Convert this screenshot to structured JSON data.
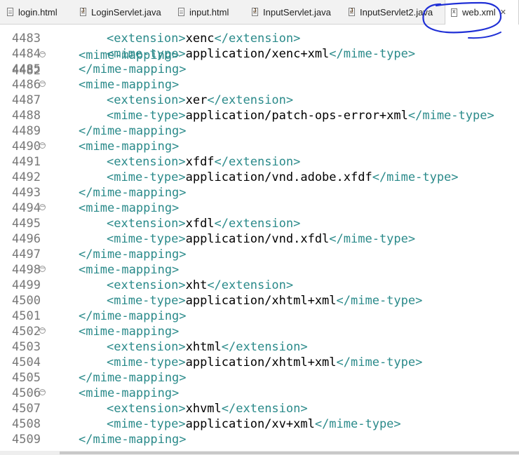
{
  "tabs": [
    {
      "label": "login.html",
      "icon": "html-file-icon"
    },
    {
      "label": "LoginServlet.java",
      "icon": "java-file-icon"
    },
    {
      "label": "input.html",
      "icon": "html-file-icon"
    },
    {
      "label": "InputServlet.java",
      "icon": "java-file-icon"
    },
    {
      "label": "InputServlet2.java",
      "icon": "java-file-icon"
    },
    {
      "label": "web.xml",
      "icon": "xml-file-icon",
      "active": true
    }
  ],
  "colors": {
    "tag": "#2a8a8a",
    "text": "#000000",
    "line_number": "#787878",
    "annotation": "#1f2fd6"
  },
  "editor": {
    "partial_top_line": {
      "num": "4482",
      "open": "<",
      "tag": "mime-mapping",
      "close": ">"
    },
    "lines": [
      {
        "num": "4483",
        "indent": 2,
        "open": "<extension>",
        "value": "xenc",
        "close": "</extension>"
      },
      {
        "num": "4484",
        "indent": 2,
        "open": "<mime-type>",
        "value": "application/xenc+xml",
        "close": "</mime-type>"
      },
      {
        "num": "4485",
        "indent": 1,
        "open": "</mime-mapping>"
      },
      {
        "num": "4486",
        "indent": 1,
        "open": "<mime-mapping>",
        "fold": true
      },
      {
        "num": "4487",
        "indent": 2,
        "open": "<extension>",
        "value": "xer",
        "close": "</extension>"
      },
      {
        "num": "4488",
        "indent": 2,
        "open": "<mime-type>",
        "value": "application/patch-ops-error+xml",
        "close": "</mime-type>"
      },
      {
        "num": "4489",
        "indent": 1,
        "open": "</mime-mapping>"
      },
      {
        "num": "4490",
        "indent": 1,
        "open": "<mime-mapping>",
        "fold": true
      },
      {
        "num": "4491",
        "indent": 2,
        "open": "<extension>",
        "value": "xfdf",
        "close": "</extension>"
      },
      {
        "num": "4492",
        "indent": 2,
        "open": "<mime-type>",
        "value": "application/vnd.adobe.xfdf",
        "close": "</mime-type>"
      },
      {
        "num": "4493",
        "indent": 1,
        "open": "</mime-mapping>"
      },
      {
        "num": "4494",
        "indent": 1,
        "open": "<mime-mapping>",
        "fold": true
      },
      {
        "num": "4495",
        "indent": 2,
        "open": "<extension>",
        "value": "xfdl",
        "close": "</extension>"
      },
      {
        "num": "4496",
        "indent": 2,
        "open": "<mime-type>",
        "value": "application/vnd.xfdl",
        "close": "</mime-type>"
      },
      {
        "num": "4497",
        "indent": 1,
        "open": "</mime-mapping>"
      },
      {
        "num": "4498",
        "indent": 1,
        "open": "<mime-mapping>",
        "fold": true
      },
      {
        "num": "4499",
        "indent": 2,
        "open": "<extension>",
        "value": "xht",
        "close": "</extension>"
      },
      {
        "num": "4500",
        "indent": 2,
        "open": "<mime-type>",
        "value": "application/xhtml+xml",
        "close": "</mime-type>"
      },
      {
        "num": "4501",
        "indent": 1,
        "open": "</mime-mapping>"
      },
      {
        "num": "4502",
        "indent": 1,
        "open": "<mime-mapping>",
        "fold": true
      },
      {
        "num": "4503",
        "indent": 2,
        "open": "<extension>",
        "value": "xhtml",
        "close": "</extension>"
      },
      {
        "num": "4504",
        "indent": 2,
        "open": "<mime-type>",
        "value": "application/xhtml+xml",
        "close": "</mime-type>"
      },
      {
        "num": "4505",
        "indent": 1,
        "open": "</mime-mapping>"
      },
      {
        "num": "4506",
        "indent": 1,
        "open": "<mime-mapping>",
        "fold": true
      },
      {
        "num": "4507",
        "indent": 2,
        "open": "<extension>",
        "value": "xhvml",
        "close": "</extension>"
      },
      {
        "num": "4508",
        "indent": 2,
        "open": "<mime-type>",
        "value": "application/xv+xml",
        "close": "</mime-type>"
      },
      {
        "num": "4509",
        "indent": 1,
        "open": "</mime-mapping>"
      }
    ]
  }
}
